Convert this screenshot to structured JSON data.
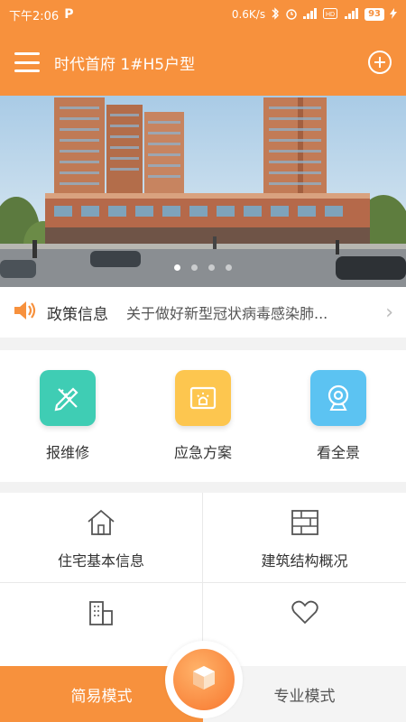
{
  "status_bar": {
    "time": "下午2:06",
    "app_badge": "P",
    "network_speed": "0.6K/s",
    "battery": "93"
  },
  "app_bar": {
    "title": "时代首府 1#H5户型"
  },
  "banner": {
    "slide_count": 4,
    "active_slide": 1
  },
  "notice": {
    "label": "政策信息",
    "message": "关于做好新型冠状病毒感染肺..."
  },
  "quick_actions": [
    {
      "label": "报维修",
      "icon": "pencil-ruler-icon",
      "color": "#3fcdb4"
    },
    {
      "label": "应急方案",
      "icon": "alarm-board-icon",
      "color": "#fdc64f"
    },
    {
      "label": "看全景",
      "icon": "camera-icon",
      "color": "#5cc3f2"
    }
  ],
  "grid": [
    {
      "label": "住宅基本信息",
      "icon": "house-icon"
    },
    {
      "label": "建筑结构概况",
      "icon": "brick-wall-icon"
    },
    {
      "label": "",
      "icon": "building-icon"
    },
    {
      "label": "",
      "icon": "heart-icon"
    }
  ],
  "bottom_nav": {
    "left_label": "简易模式",
    "right_label": "专业模式",
    "center_icon": "cube-icon"
  },
  "colors": {
    "primary": "#f7913d"
  }
}
